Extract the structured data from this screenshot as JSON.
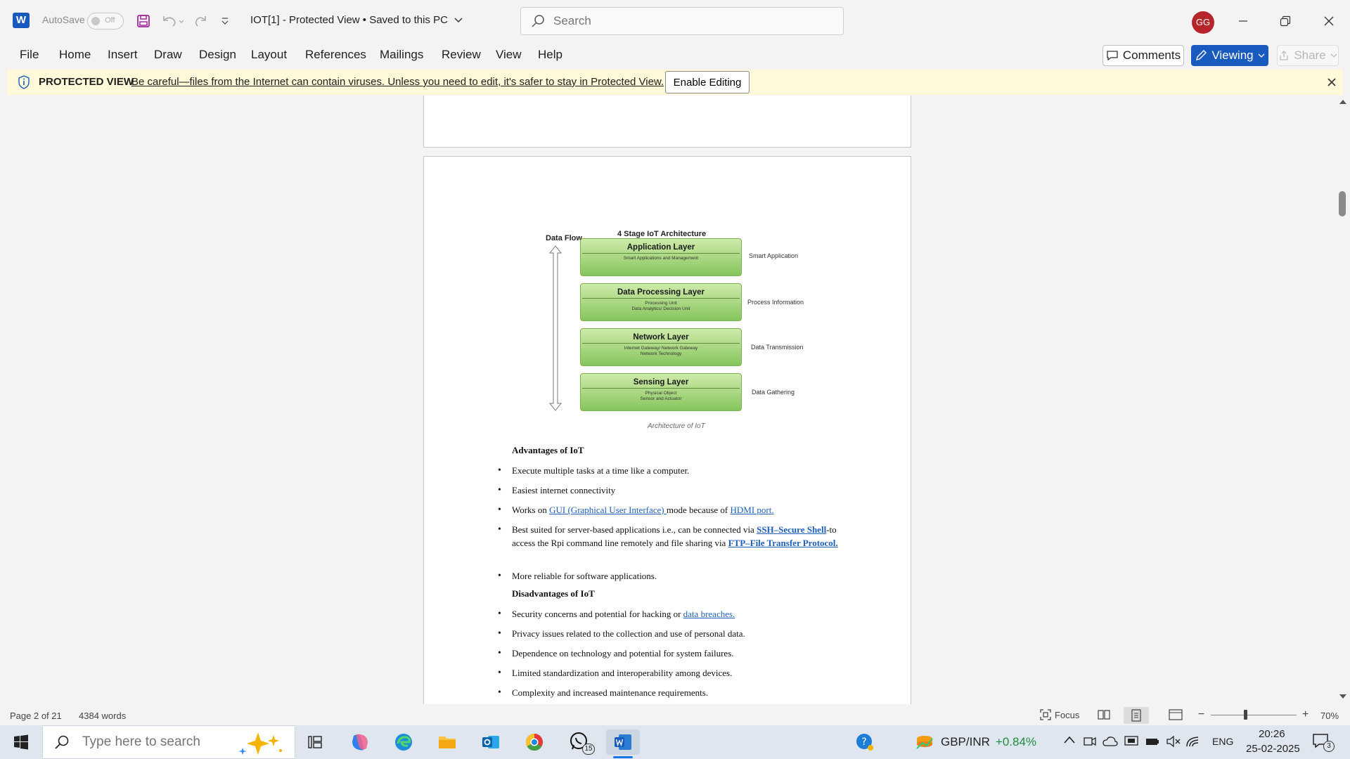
{
  "titlebar": {
    "autosave_label": "AutoSave",
    "autosave_state": "Off",
    "doc_title": "IOT[1]  -  Protected View • Saved to this PC",
    "search_placeholder": "Search",
    "avatar_initials": "GG"
  },
  "ribbon": {
    "tabs": [
      "File",
      "Home",
      "Insert",
      "Draw",
      "Design",
      "Layout",
      "References",
      "Mailings",
      "Review",
      "View",
      "Help"
    ],
    "comments_label": "Comments",
    "viewing_label": "Viewing",
    "share_label": "Share"
  },
  "protected_view": {
    "title": "PROTECTED VIEW",
    "message": "Be careful—files from the Internet can contain viruses. Unless you need to edit, it's safer to stay in Protected View.",
    "enable_label": "Enable Editing"
  },
  "diagram": {
    "title": "4 Stage IoT Architecture",
    "flow_label": "Data Flow",
    "caption": "Architecture of IoT",
    "layers": [
      {
        "name": "Application Layer",
        "desc1": "Smart Applications and Management",
        "desc2": "",
        "side": "Smart Application"
      },
      {
        "name": "Data Processing Layer",
        "desc1": "Processing Unit",
        "desc2": "Data Analytics/ Decision Unit",
        "side": "Process Information"
      },
      {
        "name": "Network Layer",
        "desc1": "Internet Gateway/ Network Gateway",
        "desc2": "Network Technology",
        "side": "Data Transmission"
      },
      {
        "name": "Sensing Layer",
        "desc1": "Physical Object",
        "desc2": "Sensor and Actuator",
        "side": "Data Gathering"
      }
    ]
  },
  "document": {
    "advantages_heading": "Advantages of IoT",
    "adv1": "Execute multiple tasks at a time like a computer.",
    "adv2": "Easiest internet connectivity",
    "adv3_pre": "Works on ",
    "adv3_link1": "GUI (Graphical User Interface) ",
    "adv3_mid": "mode because of ",
    "adv3_link2": "HDMI port.",
    "adv4_pre": "Best suited for server-based applications i.e., can be connected via ",
    "adv4_link1": "SSH–Secure Shell",
    "adv4_mid": "-to access the Rpi command line remotely and file sharing via ",
    "adv4_link2": "FTP–File Transfer Protocol.",
    "adv5": "More reliable for software applications.",
    "disadvantages_heading": "Disadvantages of IoT",
    "dis1_pre": "Security concerns and potential for hacking or ",
    "dis1_link": "data breaches.",
    "dis2": "Privacy issues related to the collection and use of personal data.",
    "dis3": "Dependence on technology and potential for system failures.",
    "dis4": "Limited standardization and interoperability among devices.",
    "dis5": "Complexity and increased maintenance requirements."
  },
  "statusbar": {
    "page": "Page 2 of 21",
    "words": "4384 words",
    "focus": "Focus",
    "zoom": "70%",
    "zoom_fraction": 0.4
  },
  "taskbar": {
    "search_placeholder": "Type here to search",
    "whatsapp_badge": "15",
    "ticker": "GBP/INR",
    "ticker_change": "+0.84%",
    "language": "ENG",
    "time": "20:26",
    "date": "25-02-2025",
    "notification_count": "3"
  },
  "colors": {
    "word_blue": "#185abd",
    "pv_background": "#fff8d9",
    "link": "#1e5fb8",
    "ticker_up": "#1e8e3e"
  }
}
